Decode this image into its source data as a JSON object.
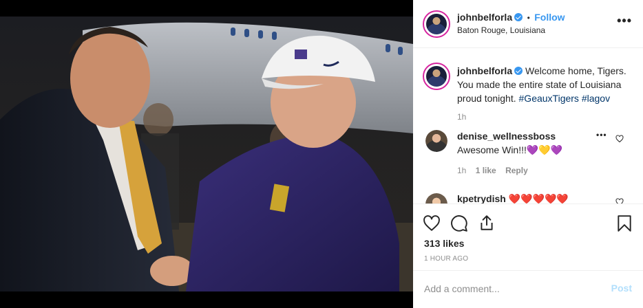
{
  "post": {
    "author": {
      "username": "johnbelforla",
      "verified": true,
      "location": "Baton Rouge, Louisiana",
      "follow_label": "Follow",
      "separator": "•"
    },
    "caption": {
      "username": "johnbelforla",
      "text": "Welcome home, Tigers. You made the entire state of Louisiana proud tonight.",
      "hashtags": [
        "#GeauxTigers",
        "#lagov"
      ],
      "age": "1h"
    },
    "comments": [
      {
        "username": "denise_wellnessboss",
        "text": "Awesome Win!!!💜💛💜",
        "age": "1h",
        "likes_label": "1 like",
        "reply_label": "Reply"
      },
      {
        "username": "kpetrydish",
        "text": "❤️❤️❤️❤️❤️"
      }
    ],
    "likes_label": "313 likes",
    "timestamp": "1 HOUR AGO",
    "comment_placeholder": "Add a comment...",
    "post_label": "Post"
  },
  "icons": {
    "more": "more-options-icon",
    "like": "heart-icon",
    "comment": "comment-icon",
    "share": "share-icon",
    "save": "bookmark-icon"
  },
  "colors": {
    "accent": "#3897f0",
    "link": "#003569",
    "muted": "#8e8e8e",
    "post_disabled": "#b2dffc"
  }
}
